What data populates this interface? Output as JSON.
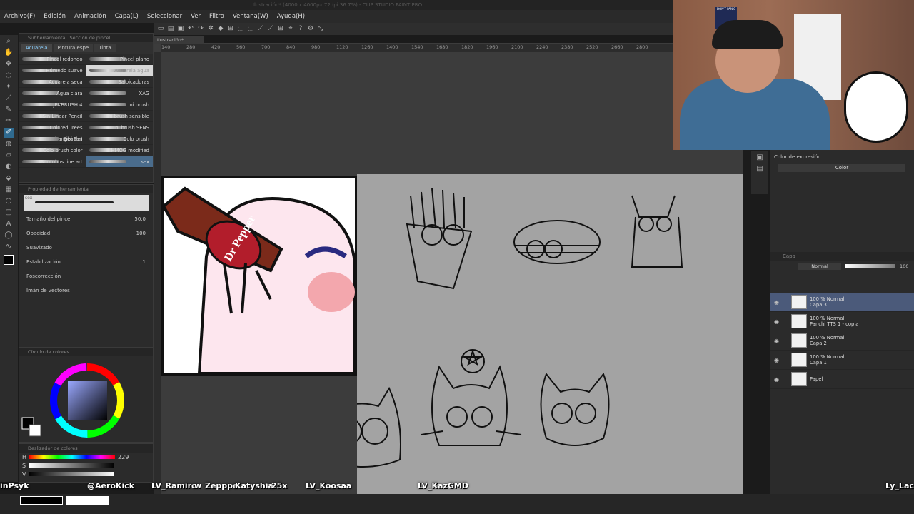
{
  "window": {
    "title": "Ilustración* (4000 x 4000px 72dpi 36.7%) - CLIP STUDIO PAINT PRO"
  },
  "menu": [
    "Archivo(F)",
    "Edición",
    "Animación",
    "Capa(L)",
    "Seleccionar",
    "Ver",
    "Filtro",
    "Ventana(W)",
    "Ayuda(H)"
  ],
  "canvas_tab": "Ilustración*",
  "brush_panel": {
    "tabs": [
      "Subherramienta",
      "Sección de pincel"
    ],
    "subtabs": [
      "Acuarela",
      "Pintura espe",
      "Tinta"
    ],
    "brushes": [
      [
        "Pincel redondo",
        "Pincel plano"
      ],
      [
        "Húmedo suave",
        "Acuarela agua"
      ],
      [
        "Acuarela seca",
        "Salpicaduras"
      ],
      [
        "Agua clara",
        "XAG"
      ],
      [
        "JEKBRUSH 4",
        "ni brush"
      ],
      [
        "Sin Linear Pencil",
        "ni brush sensible"
      ],
      [
        "Colored Trees (Changeable)",
        "ni brush SENS"
      ],
      [
        "Bibi Pen",
        "Colo brush"
      ],
      [
        "Colo brush color",
        "HMOG modified"
      ],
      [
        "Succubus line art",
        "sex"
      ]
    ]
  },
  "tool_properties": {
    "header": "Propiedad de herramienta",
    "brush_name": "sex",
    "rows": [
      {
        "label": "Tamaño del pincel",
        "value": "50.0"
      },
      {
        "label": "Opacidad",
        "value": "100"
      },
      {
        "label": "Suavizado",
        "value": ""
      },
      {
        "label": "Estabilización",
        "value": "1"
      },
      {
        "label": "Poscorrección",
        "value": ""
      },
      {
        "label": "Imán de vectores",
        "value": ""
      }
    ]
  },
  "color_panel": {
    "header": "Círculo de colores"
  },
  "slider_panel": {
    "header": "Deslizador de colores",
    "h_label": "H",
    "h_value": "229",
    "s_label": "S",
    "v_label": "V"
  },
  "expression_panel": {
    "label": "Color de expresión",
    "value": "Color"
  },
  "layer_panel": {
    "tab": "Capa",
    "blend_mode": "Normal",
    "opacity": "100",
    "layers": [
      {
        "mode": "100 % Normal",
        "name": "Capa 3",
        "selected": true
      },
      {
        "mode": "100 % Normal",
        "name": "Panchi TTS 1 - copia",
        "selected": false
      },
      {
        "mode": "100 % Normal",
        "name": "Capa 2",
        "selected": false
      },
      {
        "mode": "100 % Normal",
        "name": "Capa 1",
        "selected": false
      },
      {
        "mode": "",
        "name": "Papel",
        "selected": false
      }
    ]
  },
  "ruler_ticks": [
    "140",
    "280",
    "420",
    "560",
    "700",
    "840",
    "980",
    "1120",
    "1260",
    "1400",
    "1540",
    "1680",
    "1820",
    "1960",
    "2100",
    "2240",
    "2380",
    "2520",
    "2660",
    "2800"
  ],
  "emote": {
    "bottle_text": "Dr Pepper"
  },
  "chat_names": [
    "inPsyk",
    "@AeroKick",
    "LV_Ramiro",
    "w",
    "Zepppe",
    "Katyshia",
    "25x",
    "LV_Koosaa",
    "LV_KazGMD",
    "Ly_Lac"
  ],
  "webcam": {
    "shirt_text": "",
    "poster_text": "DON'T PANIC"
  },
  "colors": {
    "accent": "#4a6c8c",
    "fg": "#000000",
    "bg": "#ffffff"
  }
}
